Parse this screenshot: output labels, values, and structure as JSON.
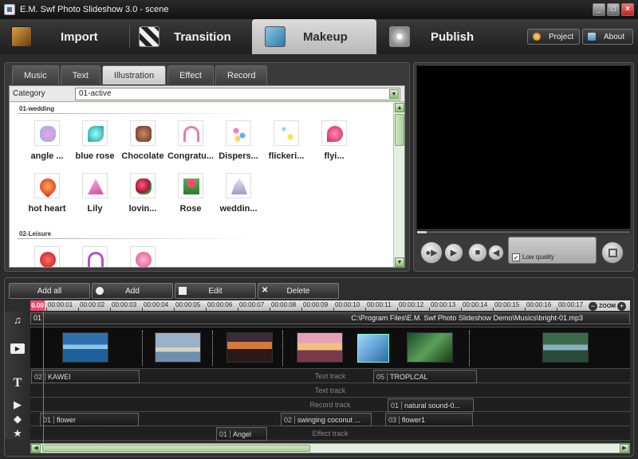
{
  "window": {
    "title": "E.M. Swf Photo Slideshow 3.0 - scene",
    "controls": [
      "_",
      "□",
      "×"
    ]
  },
  "main_tabs": [
    {
      "label": "Import",
      "icon": "import-icon",
      "active": false
    },
    {
      "label": "Transition",
      "icon": "transition-icon",
      "active": false
    },
    {
      "label": "Makeup",
      "icon": "makeup-icon",
      "active": true
    },
    {
      "label": "Publish",
      "icon": "publish-icon",
      "active": false
    }
  ],
  "top_buttons": {
    "project": "Project",
    "about": "About"
  },
  "sub_tabs": [
    {
      "label": "Music",
      "active": false
    },
    {
      "label": "Text",
      "active": false
    },
    {
      "label": "Illustration",
      "active": true
    },
    {
      "label": "Effect",
      "active": false
    },
    {
      "label": "Record",
      "active": false
    }
  ],
  "library": {
    "category_label": "Category",
    "category_value": "01-active",
    "group1": "01-wedding",
    "group2": "02-Leisure",
    "row1": [
      "angle ...",
      "blue rose",
      "Chocolate",
      "Congratu...",
      "Dispers...",
      "flickeri...",
      "flyi..."
    ],
    "row2": [
      "hot heart",
      "Lily",
      "lovin...",
      "Rose",
      "weddin..."
    ]
  },
  "preview": {
    "low_quality_label": "Low quality",
    "low_quality_checked": true
  },
  "timeline": {
    "buttons": {
      "add_all": "Add all",
      "add": "Add",
      "edit": "Edit",
      "delete": "Delete"
    },
    "cursor_time": "0.00",
    "ticks": [
      "00:00:01",
      "00:00:02",
      "00:00:03",
      "00:00:04",
      "00:00:05",
      "00:00:06",
      "00:00:07",
      "00:00:08",
      "00:00:09",
      "00:00:10",
      "00:00:11",
      "00:00:12",
      "00:00:13",
      "00:00:14",
      "00:00:15",
      "00:00:16",
      "00:00:17"
    ],
    "zoom_label": "ZOOM",
    "music": {
      "index": "01",
      "path": "C:\\Program Files\\E.M. Swf Photo Slideshow Demo\\Musics\\bright-01.mp3"
    },
    "text_track_label": "Text track",
    "text_clips": [
      {
        "n": "02",
        "label": "KAWEI"
      },
      {
        "n": "05",
        "label": "TROPLCAL"
      }
    ],
    "record_track_label": "Record track",
    "record_clips": [
      {
        "n": "01",
        "label": "natural sound-0..."
      }
    ],
    "illustration_clips": [
      {
        "n": "01",
        "label": "flower"
      },
      {
        "n": "02",
        "label": "swinging coconut ..."
      },
      {
        "n": "03",
        "label": "flower1"
      }
    ],
    "effect_track_label": "Effect track",
    "effect_clips": [
      {
        "n": "01",
        "label": "Angel"
      }
    ]
  },
  "colors": {
    "accent": "#f04a6a",
    "scroll_green": "#a8d096",
    "panel_bg": "#3a3a3a"
  }
}
